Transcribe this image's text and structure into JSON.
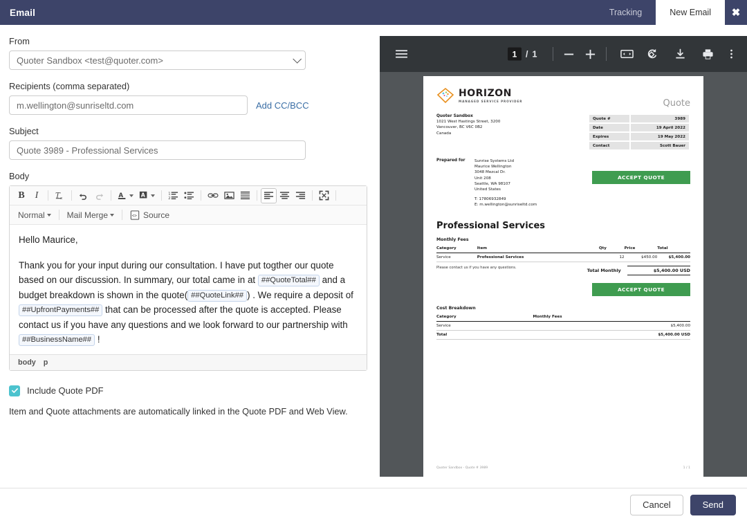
{
  "window": {
    "title": "Email",
    "tabs": [
      {
        "label": "Tracking",
        "active": false
      },
      {
        "label": "New Email",
        "active": true
      }
    ],
    "close_label": "✖",
    "accent_color": "#3d4469"
  },
  "form": {
    "from_label": "From",
    "from_value": "Quoter Sandbox <test@quoter.com>",
    "recipients_label": "Recipients (comma separated)",
    "recipients_value": "m.wellington@sunriseltd.com",
    "cc_bcc_link": "Add CC/BCC",
    "subject_label": "Subject",
    "subject_value": "Quote 3989 - Professional Services",
    "body_label": "Body"
  },
  "toolbar": {
    "bold": "B",
    "italic": "I",
    "remove_format": "Tx",
    "undo": "undo-arrow",
    "redo": "redo-arrow",
    "text_color": "A",
    "bg_color": "A",
    "ordered_list": "numbered-list",
    "unordered_list": "bullet-list",
    "link": "link",
    "image": "image",
    "blocks": "blocks",
    "align_left": "align-left",
    "align_center": "align-center",
    "align_right": "align-right",
    "maximize": "maximize",
    "format_select": "Normal",
    "merge_select": "Mail Merge",
    "source_label": "Source"
  },
  "body": {
    "greeting": "Hello Maurice,",
    "para_prefix": "Thank you for your input during our consultation. I have put togther our quote based on our discussion. In summary, our total came in at ",
    "tag_total": "##QuoteTotal##",
    "para_mid1": " and a budget breakdown is shown in the quote(",
    "tag_link": "##QuoteLink##",
    "para_mid2": ") . We require a deposit of ",
    "tag_upfront": "##UpfrontPayments##",
    "para_mid3": " that can be processed after the quote is accepted. Please contact us if you have any questions and we look forward to our partnership with ",
    "tag_business": "##BusinessName##",
    "para_end": " !",
    "status_path_1": "body",
    "status_path_2": "p"
  },
  "options": {
    "include_pdf_label": "Include Quote PDF",
    "include_pdf_checked": true,
    "checkbox_color": "#4cc3ce",
    "helper_text": "Item and Quote attachments are automatically linked in the Quote PDF and Web View."
  },
  "pdf_viewer": {
    "menu_icon": "hamburger-menu-icon",
    "current_page": "1",
    "page_separator": "/",
    "total_pages": "1",
    "zoom_out": "−",
    "zoom_in": "+",
    "fit_icon": "fit-to-page-icon",
    "rotate_icon": "rotate-icon",
    "download_icon": "download-icon",
    "print_icon": "print-icon",
    "more_icon": "more-options-icon"
  },
  "quote_doc": {
    "logo_name": "HORIZON",
    "logo_tagline": "MANAGED SERVICE PROVIDER",
    "doc_type": "Quote",
    "company": {
      "name": "Quoter Sandbox",
      "line1": "1021 West Hastings Street, 3200",
      "line2": "Vancouver, BC V6C 0B2",
      "line3": "Canada"
    },
    "meta": [
      {
        "label": "Quote #",
        "value": "3989"
      },
      {
        "label": "Date",
        "value": "19 April 2022"
      },
      {
        "label": "Expires",
        "value": "19 May 2022"
      },
      {
        "label": "Contact",
        "value": "Scott Bauer"
      }
    ],
    "prepared_for_label": "Prepared for",
    "prepared_for": {
      "company": "Sunrise Systems Ltd",
      "person": "Maurice Wellington",
      "street": "3048 Mezcal Dr.",
      "unit": "Unit 208",
      "city": "Seattle, WA 98107",
      "country": "United States",
      "phone": "T: 17806932849",
      "email": "E: m.wellington@sunriseltd.com"
    },
    "accept_button": "ACCEPT QUOTE",
    "accept_color": "#3f9c50",
    "section_title": "Professional Services",
    "monthly_fees": {
      "title": "Monthly Fees",
      "headers": [
        "Category",
        "Item",
        "Qty",
        "Price",
        "Total"
      ],
      "rows": [
        {
          "category": "Service",
          "item": "Professional Services",
          "qty": "12",
          "price": "$450.00",
          "total": "$5,400.00"
        }
      ],
      "note": "Please contact us if you have any questions.",
      "total_label": "Total Monthly",
      "total_value": "$5,400.00 USD"
    },
    "cost_breakdown": {
      "title": "Cost Breakdown",
      "headers": [
        "Category",
        "Monthly Fees"
      ],
      "rows": [
        {
          "category": "Service",
          "value": "$5,400.00"
        }
      ],
      "total_label": "Total",
      "total_value": "$5,400.00 USD"
    },
    "footer_left": "Quoter Sandbox - Quote # 3989",
    "footer_right": "1 / 1"
  },
  "actions": {
    "cancel_label": "Cancel",
    "send_label": "Send"
  }
}
